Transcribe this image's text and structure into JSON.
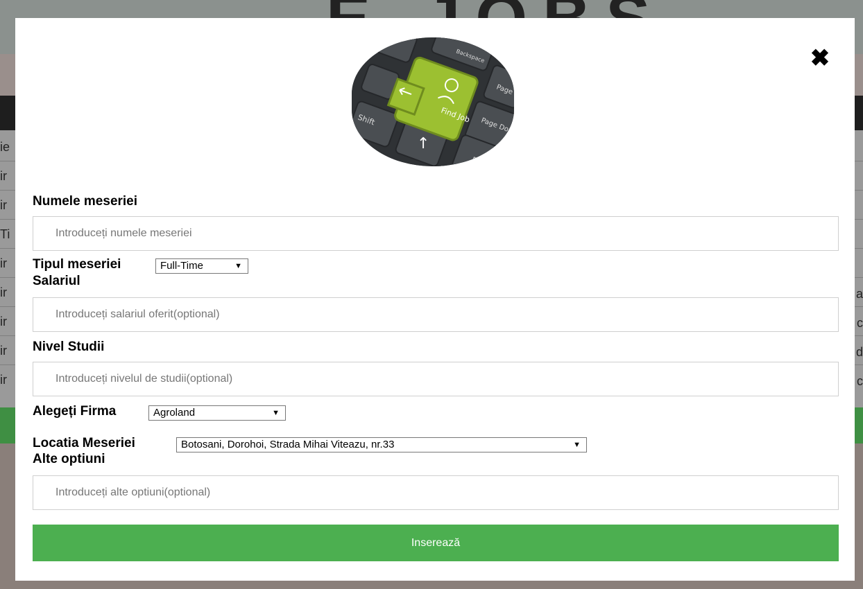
{
  "background": {
    "site_title": "E-JOBS",
    "table_cells_left": [
      "ie",
      "ir",
      "ir",
      "Ti",
      "ir",
      "ir",
      "ir",
      "ir",
      "ir"
    ],
    "table_cells_right": [
      "a",
      "c",
      "d",
      "c"
    ]
  },
  "modal": {
    "close_icon": "close-icon",
    "logo": {
      "key_label": "Find Job",
      "keys": [
        "Backspace",
        "Shift",
        "Page Up",
        "Page Down",
        "En"
      ]
    },
    "fields": {
      "job_name": {
        "label": "Numele meseriei",
        "placeholder": "Introduceți numele meseriei",
        "value": ""
      },
      "job_type": {
        "label": "Tipul meseriei",
        "selected": "Full-Time"
      },
      "salary": {
        "label": "Salariul",
        "placeholder": "Introduceți salariul oferit(optional)",
        "value": ""
      },
      "education": {
        "label": "Nivel Studii",
        "placeholder": "Introduceți nivelul de studii(optional)",
        "value": ""
      },
      "company": {
        "label": "Alegeți Firma",
        "selected": "Agroland"
      },
      "location": {
        "label": "Locatia Meseriei",
        "selected": "Botosani, Dorohoi, Strada Mihai Viteazu, nr.33"
      },
      "other": {
        "label": "Alte optiuni",
        "placeholder": "Introduceți alte optiuni(optional)",
        "value": ""
      }
    },
    "submit_label": "Inserează"
  },
  "colors": {
    "submit": "#4caf50",
    "modal_bg": "#ffffff",
    "overlay": "#8a8f8c",
    "logo_key_green": "#9cc031"
  }
}
